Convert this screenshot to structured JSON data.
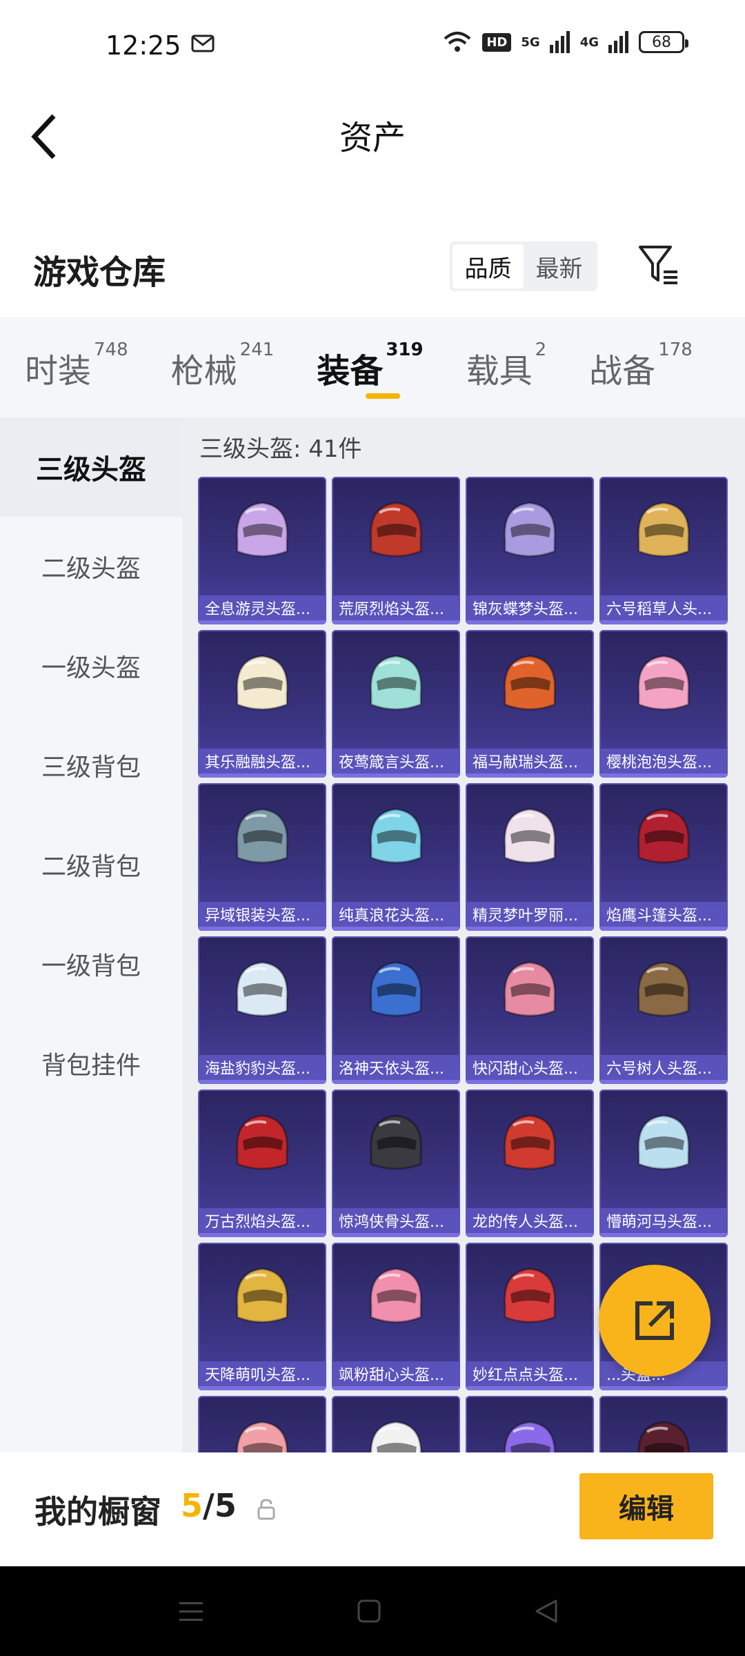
{
  "status_bar": {
    "time": "12:25",
    "battery": "68",
    "hd_label": "HD",
    "net1": "5G",
    "net2": "4G"
  },
  "header": {
    "title": "资产"
  },
  "section": {
    "title": "游戏仓库"
  },
  "sort": {
    "options": [
      "品质",
      "最新"
    ],
    "selected": "品质"
  },
  "tabs": [
    {
      "label": "时装",
      "count": "748"
    },
    {
      "label": "枪械",
      "count": "241"
    },
    {
      "label": "装备",
      "count": "319",
      "active": true
    },
    {
      "label": "载具",
      "count": "2"
    },
    {
      "label": "战备",
      "count": "178"
    }
  ],
  "subnav": [
    "三级头盔",
    "二级头盔",
    "一级头盔",
    "三级背包",
    "二级背包",
    "一级背包",
    "背包挂件"
  ],
  "grid": {
    "count_label": "三级头盔: 41件",
    "items": [
      {
        "name": "全息游灵头盔...",
        "color": "#c9a6e8"
      },
      {
        "name": "荒原烈焰头盔...",
        "color": "#c0392b"
      },
      {
        "name": "锦灰蝶梦头盔...",
        "color": "#a99be0"
      },
      {
        "name": "六号稻草人头...",
        "color": "#e0b35a"
      },
      {
        "name": "其乐融融头盔...",
        "color": "#f3ead0"
      },
      {
        "name": "夜莺箴言头盔...",
        "color": "#9fe0d8"
      },
      {
        "name": "福马献瑞头盔...",
        "color": "#e0632c"
      },
      {
        "name": "樱桃泡泡头盔...",
        "color": "#f4a3c4"
      },
      {
        "name": "异域银装头盔...",
        "color": "#7e9aa6"
      },
      {
        "name": "纯真浪花头盔...",
        "color": "#7fd4e8"
      },
      {
        "name": "精灵梦叶罗丽...",
        "color": "#f0e2ea"
      },
      {
        "name": "焰鹰斗篷头盔...",
        "color": "#b02030"
      },
      {
        "name": "海盐豹豹头盔...",
        "color": "#dbe9f4"
      },
      {
        "name": "洛神天依头盔...",
        "color": "#3b6fd0"
      },
      {
        "name": "快闪甜心头盔...",
        "color": "#e78ba2"
      },
      {
        "name": "六号树人头盔...",
        "color": "#8a6a44"
      },
      {
        "name": "万古烈焰头盔...",
        "color": "#c2262a"
      },
      {
        "name": "惊鸿侠骨头盔...",
        "color": "#3a3a40"
      },
      {
        "name": "龙的传人头盔...",
        "color": "#d13a2f"
      },
      {
        "name": "懵萌河马头盔...",
        "color": "#bcdff0"
      },
      {
        "name": "天降萌叽头盔...",
        "color": "#e2b440"
      },
      {
        "name": "飒粉甜心头盔...",
        "color": "#f08fae"
      },
      {
        "name": "妙红点点头盔...",
        "color": "#d93a3a"
      },
      {
        "name": "...头盔...",
        "color": "#e8e2c0"
      },
      {
        "name": "",
        "color": "#f2a0a8"
      },
      {
        "name": "",
        "color": "#f1f1f1"
      },
      {
        "name": "",
        "color": "#8a6ae8"
      },
      {
        "name": "",
        "color": "#5a2030"
      }
    ]
  },
  "showcase": {
    "label": "我的橱窗",
    "current": "5",
    "total": "/5",
    "edit_label": "编辑"
  }
}
